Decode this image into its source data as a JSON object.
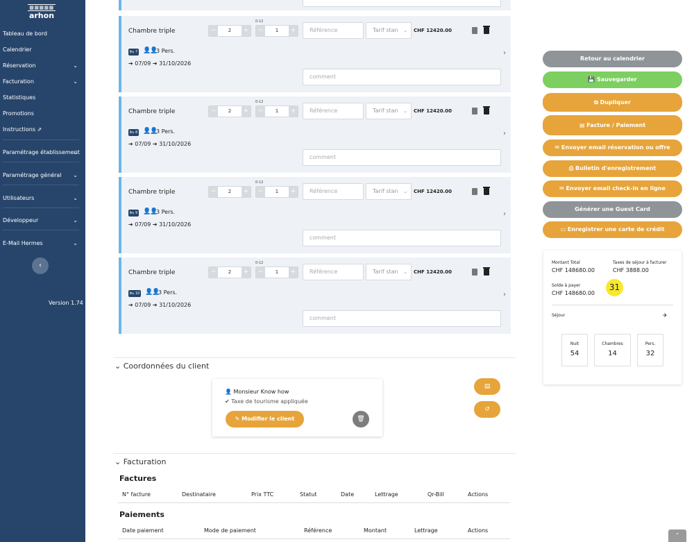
{
  "sidebar": {
    "logo_mark": "arhon",
    "logo_text": "arhon",
    "items": [
      {
        "label": "Tableau de bord"
      },
      {
        "label": "Calendrier"
      },
      {
        "label": "Réservation"
      },
      {
        "label": "Facturation"
      },
      {
        "label": "Statistiques"
      },
      {
        "label": "Promotions"
      },
      {
        "label": "Instructions"
      },
      {
        "label": "Paramétrage établissement"
      },
      {
        "label": "Paramétrage général"
      },
      {
        "label": "Utilisateurs"
      },
      {
        "label": "Développeur"
      },
      {
        "label": "E-Mail Hermes"
      }
    ],
    "version": "Version 1.74"
  },
  "rooms": [
    {
      "title": "Chambre triple",
      "adults": "2",
      "age_label": "0-12",
      "children": "1",
      "ref_placeholder": "Référence",
      "tarif": "Tarif stan",
      "price": "CHF 12420.00",
      "room_no": "7",
      "persons": "3 Pers.",
      "dates": "➔ 07/09 ➔ 31/10/2026",
      "comment_placeholder": "comment"
    },
    {
      "title": "Chambre triple",
      "adults": "2",
      "age_label": "0-12",
      "children": "1",
      "ref_placeholder": "Référence",
      "tarif": "Tarif stan",
      "price": "CHF 12420.00",
      "room_no": "8",
      "persons": "3 Pers.",
      "dates": "➔ 07/09 ➔ 31/10/2026",
      "comment_placeholder": "comment"
    },
    {
      "title": "Chambre triple",
      "adults": "2",
      "age_label": "0-12",
      "children": "1",
      "ref_placeholder": "Référence",
      "tarif": "Tarif stan",
      "price": "CHF 12420.00",
      "room_no": "9",
      "persons": "3 Pers.",
      "dates": "➔ 07/09 ➔ 31/10/2026",
      "comment_placeholder": "comment"
    },
    {
      "title": "Chambre triple",
      "adults": "2",
      "age_label": "0-12",
      "children": "1",
      "ref_placeholder": "Référence",
      "tarif": "Tarif stan",
      "price": "CHF 12420.00",
      "room_no": "10",
      "persons": "3 Pers.",
      "dates": "➔ 07/09 ➔ 31/10/2026",
      "comment_placeholder": "comment"
    }
  ],
  "client_section": {
    "title": "Coordonnées du client",
    "name": "Monsieur  Know how",
    "tax": "Taxe de tourisme appliquée",
    "modify_label": "Modifier le client"
  },
  "billing_section": {
    "title": "Facturation",
    "invoices_title": "Factures",
    "invoice_headers": [
      "N° facture",
      "Destinataire",
      "Prix TTC",
      "Statut",
      "Date",
      "Lettrage",
      "Qr-Bill",
      "Actions"
    ],
    "payments_title": "Paiements",
    "payment_headers": [
      "Date paiement",
      "Mode de paiement",
      "Référence",
      "Montant",
      "Lettrage",
      "Actions"
    ]
  },
  "actions": {
    "back": "Retour au calendrier",
    "save": "Sauvegarder",
    "duplicate": "Dupliquer",
    "invoice": "Facture / Paiement",
    "email_offer": "Envoyer email réservation ou offre",
    "registration": "Bulletin d'enregistrement",
    "email_checkin": "Envoyer email check-in en ligne",
    "guest_card": "Générer une Guest Card",
    "credit_card": "Enregistrer une carte de crédit"
  },
  "summary": {
    "total_label": "Montant Total",
    "total_value": "CHF 148680.00",
    "tax_label": "Taxes de séjour à facturer",
    "tax_value": "CHF 3888.00",
    "due_label": "Solde à payer",
    "due_value": "CHF 148680.00",
    "badge": "31",
    "stay_label": "Séjour",
    "nights_label": "Nuit",
    "nights_value": "54",
    "rooms_label": "Chambres",
    "rooms_value": "14",
    "pers_label": "Pers.",
    "pers_value": "32"
  },
  "colors": {
    "sidebar": "#27456b",
    "orange": "#e7a43a",
    "green": "#7ccf60",
    "gray": "#8f9498",
    "card_accent": "#6db6ea"
  }
}
